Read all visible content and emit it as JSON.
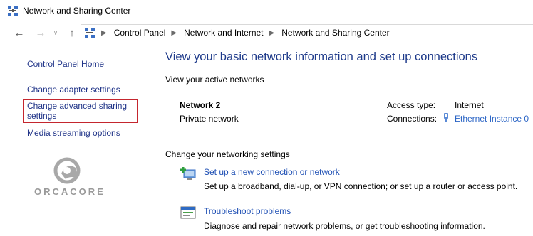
{
  "window": {
    "title": "Network and Sharing Center"
  },
  "address": {
    "breadcrumbs": [
      "Control Panel",
      "Network and Internet",
      "Network and Sharing Center"
    ]
  },
  "sidebar": {
    "home": "Control Panel Home",
    "adapter": "Change adapter settings",
    "advanced_line1": "Change advanced sharing",
    "advanced_line2": "settings",
    "media": "Media streaming options"
  },
  "watermark": {
    "text": "ORCACORE"
  },
  "main": {
    "heading": "View your basic network information and set up connections",
    "active_label": "View your active networks",
    "network": {
      "name": "Network 2",
      "type": "Private network",
      "access_label": "Access type:",
      "access_value": "Internet",
      "connections_label": "Connections:",
      "connections_value": "Ethernet Instance 0"
    },
    "settings_label": "Change your networking settings",
    "tasks": [
      {
        "link": "Set up a new connection or network",
        "desc": "Set up a broadband, dial-up, or VPN connection; or set up a router or access point.",
        "icon": "new-connection-icon"
      },
      {
        "link": "Troubleshoot problems",
        "desc": "Diagnose and repair network problems, or get troubleshooting information.",
        "icon": "troubleshoot-icon"
      }
    ]
  },
  "colors": {
    "link": "#1e3287",
    "heading": "#1e3a8a",
    "highlight": "#c4262e"
  }
}
